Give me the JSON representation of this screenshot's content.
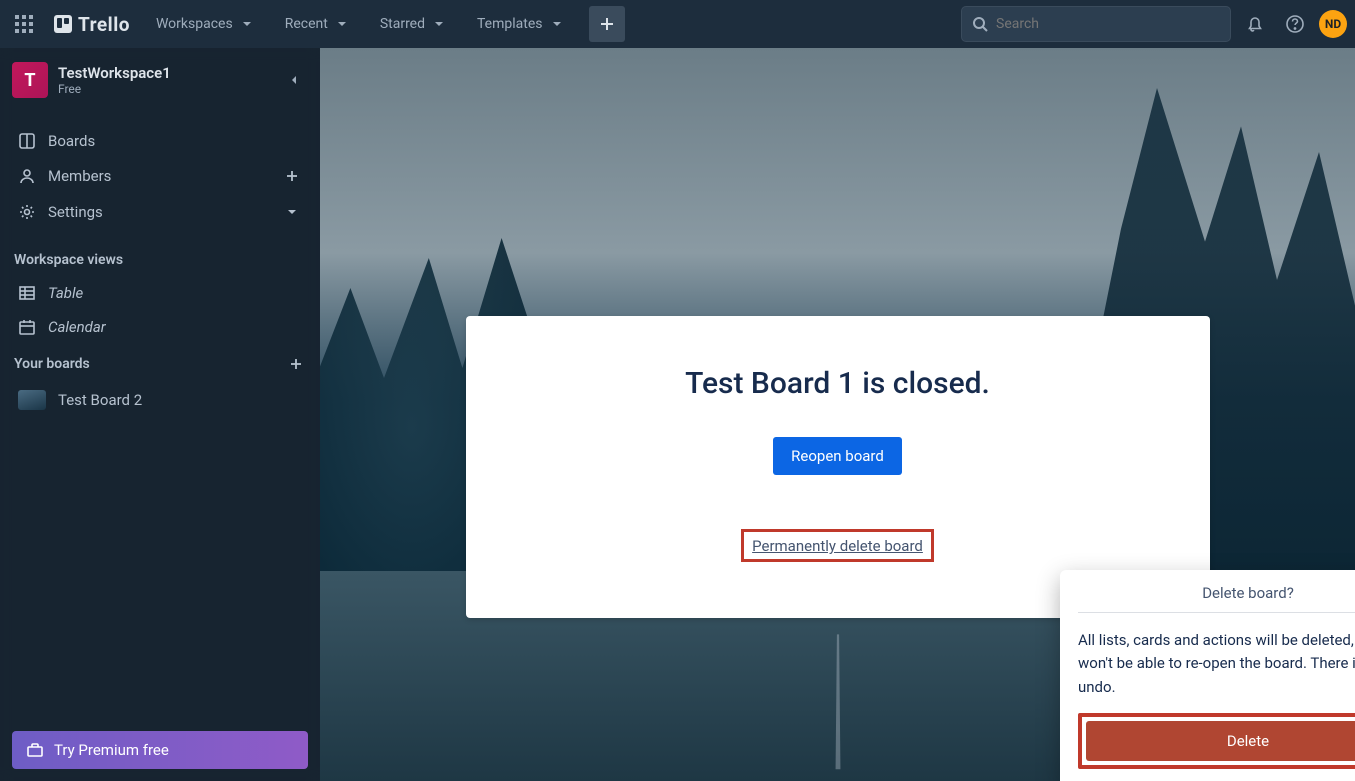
{
  "header": {
    "logo_text": "Trello",
    "nav": [
      "Workspaces",
      "Recent",
      "Starred",
      "Templates"
    ],
    "search_placeholder": "Search",
    "avatar_initials": "ND"
  },
  "sidebar": {
    "workspace": {
      "initial": "T",
      "name": "TestWorkspace1",
      "plan": "Free"
    },
    "primary": [
      {
        "icon": "board",
        "label": "Boards"
      },
      {
        "icon": "members",
        "label": "Members",
        "action": "plus"
      },
      {
        "icon": "settings",
        "label": "Settings",
        "action": "chevron"
      }
    ],
    "views_title": "Workspace views",
    "views": [
      {
        "icon": "table",
        "label": "Table"
      },
      {
        "icon": "calendar",
        "label": "Calendar"
      }
    ],
    "yourboards_title": "Your boards",
    "boards": [
      {
        "label": "Test Board 2"
      }
    ],
    "premium_label": "Try Premium free"
  },
  "closed_board": {
    "title": "Test Board 1 is closed.",
    "reopen_label": "Reopen board",
    "permdelete_label": "Permanently delete board"
  },
  "delete_popover": {
    "title": "Delete board?",
    "body": "All lists, cards and actions will be deleted, and you won't be able to re-open the board. There is no undo.",
    "delete_label": "Delete"
  }
}
